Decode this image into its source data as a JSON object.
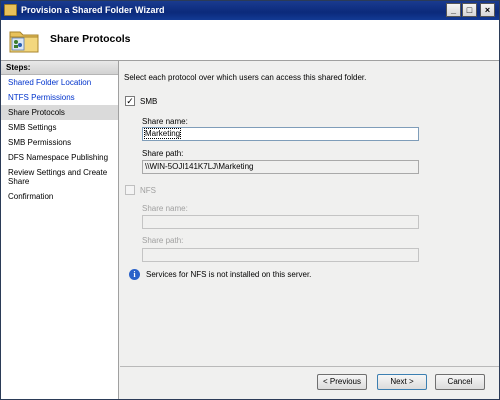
{
  "window": {
    "title": "Provision a Shared Folder Wizard",
    "controls": {
      "minimize": "_",
      "maximize": "□",
      "close": "×"
    }
  },
  "header": {
    "title": "Share Protocols"
  },
  "steps": {
    "title": "Steps:",
    "items": [
      {
        "label": "Shared Folder Location",
        "state": "visited"
      },
      {
        "label": "NTFS Permissions",
        "state": "visited"
      },
      {
        "label": "Share Protocols",
        "state": "current"
      },
      {
        "label": "SMB Settings",
        "state": "upcoming"
      },
      {
        "label": "SMB Permissions",
        "state": "upcoming"
      },
      {
        "label": "DFS Namespace Publishing",
        "state": "upcoming"
      },
      {
        "label": "Review Settings and Create Share",
        "state": "upcoming"
      },
      {
        "label": "Confirmation",
        "state": "upcoming"
      }
    ]
  },
  "content": {
    "instruction": "Select each protocol over which users can access this shared folder.",
    "smb": {
      "label": "SMB",
      "checked": true,
      "check_mark": "✓",
      "share_name_label": "Share name:",
      "share_name_value": "Marketing",
      "share_path_label": "Share path:",
      "share_path_value": "\\\\WIN-5OJI141K7LJ\\Marketing"
    },
    "nfs": {
      "label": "NFS",
      "checked": false,
      "share_name_label": "Share name:",
      "share_name_value": "",
      "share_path_label": "Share path:",
      "share_path_value": ""
    },
    "info": {
      "icon": "i",
      "text": "Services for NFS is not installed on this server."
    }
  },
  "footer": {
    "previous": "< Previous",
    "next": "Next >",
    "cancel": "Cancel"
  },
  "colors": {
    "titlebar": "#0b2a7b",
    "link": "#0033cc",
    "info_icon": "#2a62c9"
  }
}
